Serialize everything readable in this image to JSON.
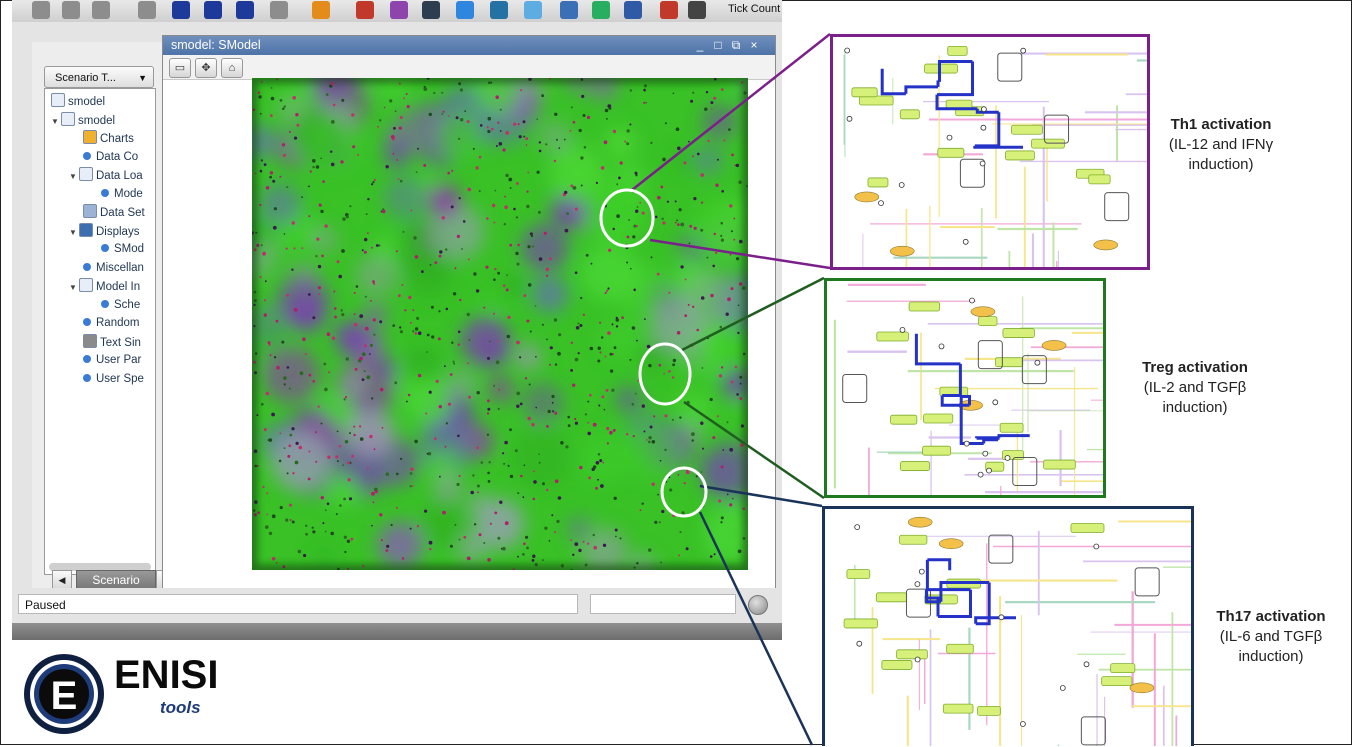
{
  "toolbar": {
    "buttons": [
      "stop-icon",
      "save-icon",
      "db-icon",
      "reset-icon",
      "play-icon",
      "step-icon",
      "pause-icon",
      "chat-icon",
      "tools-icon",
      "chart-icon",
      "pie-icon",
      "shield-icon",
      "globe-icon",
      "search-icon",
      "gear-icon",
      "table-icon",
      "map-icon",
      "grid-icon",
      "brush-icon",
      "gamepad-icon"
    ],
    "tick_label": "Tick Count"
  },
  "scenario": {
    "header": "Scenario T...",
    "items": [
      {
        "label": "smodel",
        "depth": 0,
        "icon": "doc-icon",
        "expanded": null
      },
      {
        "label": "smodel",
        "depth": 0,
        "icon": "doc-icon",
        "expanded": true
      },
      {
        "label": "Charts",
        "depth": 1,
        "icon": "charts-icon",
        "expanded": null
      },
      {
        "label": "Data Co",
        "depth": 1,
        "icon": "dot-icon",
        "expanded": null
      },
      {
        "label": "Data Loa",
        "depth": 1,
        "icon": "doc-icon",
        "expanded": true
      },
      {
        "label": "Mode",
        "depth": 2,
        "icon": "dot-icon",
        "expanded": null
      },
      {
        "label": "Data Set",
        "depth": 1,
        "icon": "dataset-icon",
        "expanded": null
      },
      {
        "label": "Displays",
        "depth": 1,
        "icon": "monitor-icon",
        "expanded": true
      },
      {
        "label": "SMod",
        "depth": 2,
        "icon": "dot-icon",
        "expanded": null
      },
      {
        "label": "Miscellan",
        "depth": 1,
        "icon": "dot-icon",
        "expanded": null
      },
      {
        "label": "Model In",
        "depth": 1,
        "icon": "doc-icon",
        "expanded": true
      },
      {
        "label": "Sche",
        "depth": 2,
        "icon": "dot-icon",
        "expanded": null
      },
      {
        "label": "Random",
        "depth": 1,
        "icon": "dot-icon",
        "expanded": null
      },
      {
        "label": "Text Sin",
        "depth": 1,
        "icon": "db-icon",
        "expanded": null
      },
      {
        "label": "User Par",
        "depth": 1,
        "icon": "dot-icon",
        "expanded": null
      },
      {
        "label": "User Spe",
        "depth": 1,
        "icon": "dot-icon",
        "expanded": null
      }
    ],
    "tab_label": "Scenario"
  },
  "inner_window": {
    "title": "smodel: SModel",
    "controls": [
      "_",
      "□",
      "⧉",
      "×"
    ]
  },
  "status": {
    "text": "Paused",
    "right_field": ""
  },
  "panels": [
    {
      "id": "th1",
      "border_color": "#7b1f8a",
      "caption_title": "Th1 activation",
      "caption_lines": [
        "(IL-12 and IFNγ",
        "induction)"
      ]
    },
    {
      "id": "treg",
      "border_color": "#1f7a1f",
      "caption_title": "Treg activation",
      "caption_lines": [
        "(IL-2 and TGFβ",
        "induction)"
      ]
    },
    {
      "id": "th17",
      "border_color": "#1a3358",
      "caption_title": "Th17 activation",
      "caption_lines": [
        "(IL-6 and TGFβ",
        "induction)"
      ]
    }
  ],
  "logo": {
    "letter": "E",
    "name": "ENISI",
    "sub": "tools"
  },
  "colors": {
    "th1": "#7b1f8a",
    "treg": "#1f7a1f",
    "th17": "#1a3358",
    "sim_green": "#3fcf2a",
    "sim_purple": "#7a3fb0"
  }
}
